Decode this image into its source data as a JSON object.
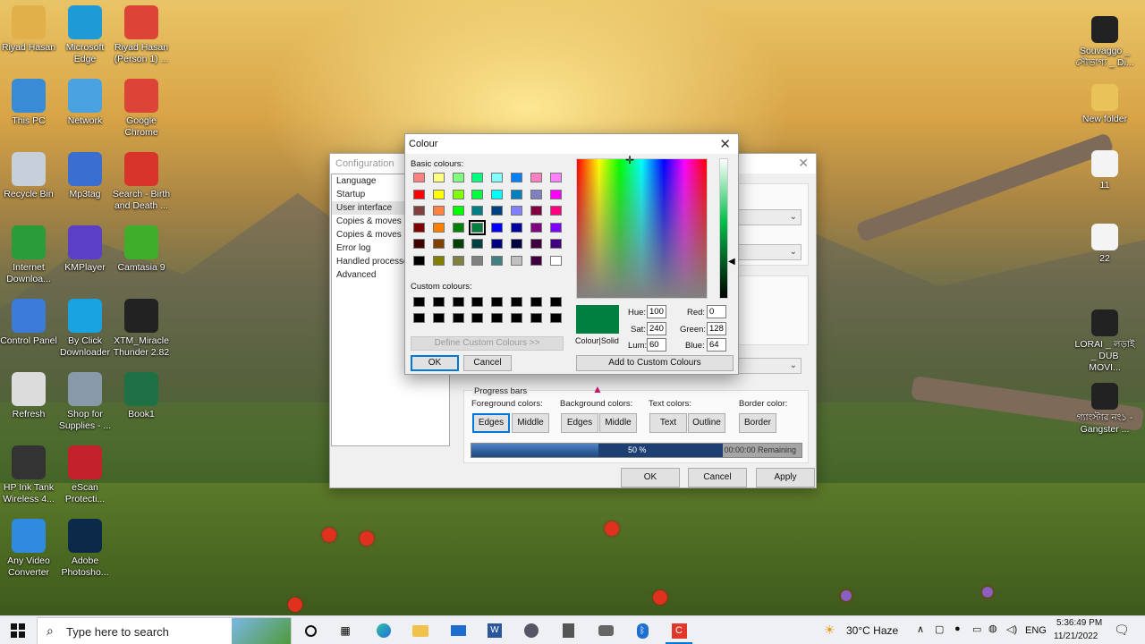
{
  "desktop": {
    "left_col1": [
      {
        "label": "Riyad Hasan",
        "icon": "user-folder-icon",
        "color": "#e2b04a"
      },
      {
        "label": "This PC",
        "icon": "computer-icon",
        "color": "#3a8bd6"
      },
      {
        "label": "Recycle Bin",
        "icon": "recycle-bin-icon",
        "color": "#c7d0da"
      },
      {
        "label": "Internet Downloa...",
        "icon": "idm-icon",
        "color": "#2a9d3a"
      },
      {
        "label": "Control Panel",
        "icon": "control-panel-icon",
        "color": "#3d7bd8"
      },
      {
        "label": "Refresh",
        "icon": "refresh-icon",
        "color": "#dcdcdc"
      },
      {
        "label": "HP Ink Tank Wireless 4...",
        "icon": "printer-icon",
        "color": "#333333"
      },
      {
        "label": "Any Video Converter",
        "icon": "video-converter-icon",
        "color": "#2f8ae0"
      }
    ],
    "left_col2": [
      {
        "label": "Microsoft Edge",
        "icon": "edge-icon",
        "color": "#1e9bd7"
      },
      {
        "label": "Network",
        "icon": "network-icon",
        "color": "#4aa3e0"
      },
      {
        "label": "Mp3tag",
        "icon": "mp3tag-icon",
        "color": "#3a6fd1"
      },
      {
        "label": "KMPlayer",
        "icon": "kmplayer-icon",
        "color": "#5b3fc4"
      },
      {
        "label": "By Click Downloader",
        "icon": "byclick-icon",
        "color": "#19a3e0"
      },
      {
        "label": "Shop for Supplies - ...",
        "icon": "shop-icon",
        "color": "#8899aa"
      },
      {
        "label": "eScan Protecti...",
        "icon": "escan-icon",
        "color": "#c4222a"
      },
      {
        "label": "Adobe Photosho...",
        "icon": "photoshop-icon",
        "color": "#0b2a4a"
      }
    ],
    "left_col3": [
      {
        "label": "Riyad Hasan (Person 1) ...",
        "icon": "chrome-icon",
        "color": "#db4437"
      },
      {
        "label": "Google Chrome",
        "icon": "chrome-icon",
        "color": "#db4437"
      },
      {
        "label": "Search - Birth and Death ...",
        "icon": "pdf-icon",
        "color": "#d9342b"
      },
      {
        "label": "Camtasia 9",
        "icon": "camtasia-icon",
        "color": "#3fae2a"
      },
      {
        "label": "XTM_Miracle Thunder 2.82",
        "icon": "xtm-icon",
        "color": "#222222"
      },
      {
        "label": "Book1",
        "icon": "excel-icon",
        "color": "#1e7145"
      }
    ],
    "right_col": [
      {
        "label": "Souvaggo _ সৌভাগ্য _ Di...",
        "icon": "video-file-icon",
        "color": "#222222"
      },
      {
        "label": "New folder",
        "icon": "folder-icon",
        "color": "#e8c35a"
      },
      {
        "label": "11",
        "icon": "document-icon",
        "color": "#f4f4f4"
      },
      {
        "label": "22",
        "icon": "document-icon",
        "color": "#f4f4f4"
      },
      {
        "label": "LORAI _ লড়াই _ DUB MOVI...",
        "icon": "video-file-icon",
        "color": "#222222"
      },
      {
        "label": "গ্যাংস্টার নং১ - Gangster ...",
        "icon": "video-file-icon",
        "color": "#222222"
      }
    ]
  },
  "config": {
    "title": "Configuration",
    "nav": [
      "Language",
      "Startup",
      "User interface",
      "Copies & moves de",
      "Copies & moves be",
      "Error log",
      "Handled processes",
      "Advanced"
    ],
    "selected_nav": 2,
    "progress_group_title": "Progress bars",
    "fg_label": "Foreground colors:",
    "bg_label": "Background colors:",
    "text_label": "Text colors:",
    "border_label": "Border color:",
    "fg_buttons": [
      "Edges",
      "Middle"
    ],
    "bg_buttons": [
      "Edges",
      "Middle"
    ],
    "text_buttons": [
      "Text",
      "Outline"
    ],
    "border_buttons": [
      "Border"
    ],
    "progress_text": "50 %",
    "progress_value": 0.5,
    "remaining_text": "00:00:00 Remaining",
    "ok": "OK",
    "cancel": "Cancel",
    "apply": "Apply"
  },
  "colour": {
    "title": "Colour",
    "basic_label": "Basic colours:",
    "custom_label": "Custom colours:",
    "basic": [
      [
        "#ff8080",
        "#ffff80",
        "#80ff80",
        "#00ff80",
        "#80ffff",
        "#0080ff",
        "#ff80c0",
        "#ff80ff"
      ],
      [
        "#ff0000",
        "#ffff00",
        "#80ff00",
        "#00ff40",
        "#00ffff",
        "#0080c0",
        "#8080c0",
        "#ff00ff"
      ],
      [
        "#804040",
        "#ff8040",
        "#00ff00",
        "#008080",
        "#004080",
        "#8080ff",
        "#800040",
        "#ff0080"
      ],
      [
        "#800000",
        "#ff8000",
        "#008000",
        "#008040",
        "#0000ff",
        "#0000a0",
        "#800080",
        "#8000ff"
      ],
      [
        "#400000",
        "#804000",
        "#004000",
        "#004040",
        "#000080",
        "#000040",
        "#400040",
        "#400080"
      ],
      [
        "#000000",
        "#808000",
        "#808040",
        "#808080",
        "#408080",
        "#c0c0c0",
        "#400040",
        "#ffffff"
      ]
    ],
    "selected_basic": [
      3,
      3
    ],
    "custom": [
      "#000000",
      "#000000",
      "#000000",
      "#000000",
      "#000000",
      "#000000",
      "#000000",
      "#000000",
      "#000000",
      "#000000",
      "#000000",
      "#000000",
      "#000000",
      "#000000",
      "#000000",
      "#000000"
    ],
    "define_custom": "Define Custom Colours >>",
    "ok": "OK",
    "cancel": "Cancel",
    "colour_solid": "Colour|Solid",
    "hue_label": "Hue:",
    "hue": "100",
    "sat_label": "Sat:",
    "sat": "240",
    "lum_label": "Lum:",
    "lum": "60",
    "red_label": "Red:",
    "red": "0",
    "green_label": "Green:",
    "green": "128",
    "blue_label": "Blue:",
    "blue": "64",
    "add_custom": "Add to Custom Colours",
    "current_color": "#008040"
  },
  "taskbar": {
    "search_placeholder": "Type here to search",
    "weather": "30°C  Haze",
    "lang": "ENG",
    "time": "5:36:49 PM",
    "date": "11/21/2022"
  }
}
